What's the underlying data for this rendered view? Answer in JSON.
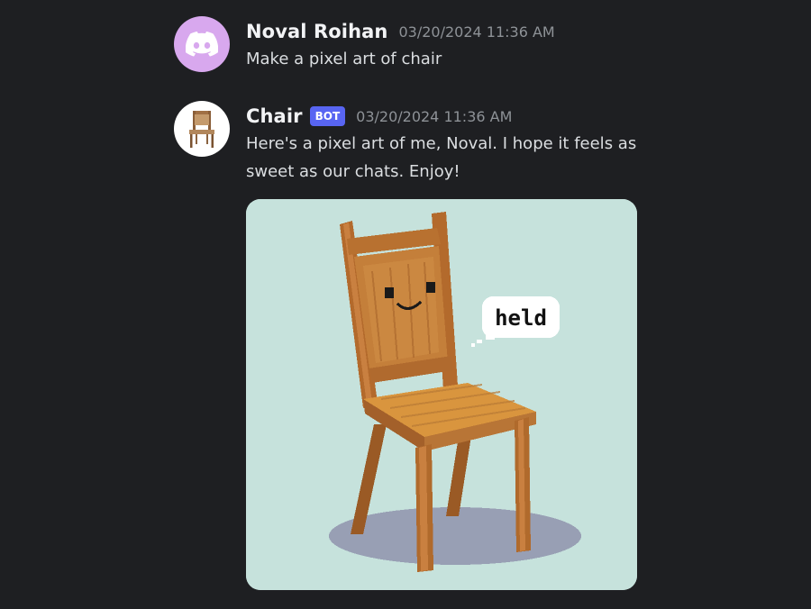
{
  "messages": [
    {
      "author": "Noval Roihan",
      "timestamp": "03/20/2024 11:36 AM",
      "avatar_icon": "discord-logo-icon",
      "avatar_color": "#d8a8ee",
      "text": "Make a pixel art of chair"
    },
    {
      "author": "Chair",
      "badge": "BOT",
      "timestamp": "03/20/2024 11:36 AM",
      "avatar_icon": "chair-icon",
      "text": "Here's a pixel art of me, Noval. I hope it feels as sweet as our chats. Enjoy!",
      "attachment": {
        "type": "image",
        "description_icon": "pixel-chair-image",
        "speech_bubble": "held",
        "background_color": "#c6e2dc"
      }
    }
  ],
  "colors": {
    "background": "#1e1f22",
    "username": "#f2f3f5",
    "timestamp": "#8e9297",
    "message_text": "#dbdee1",
    "bot_badge": "#5865f2"
  }
}
